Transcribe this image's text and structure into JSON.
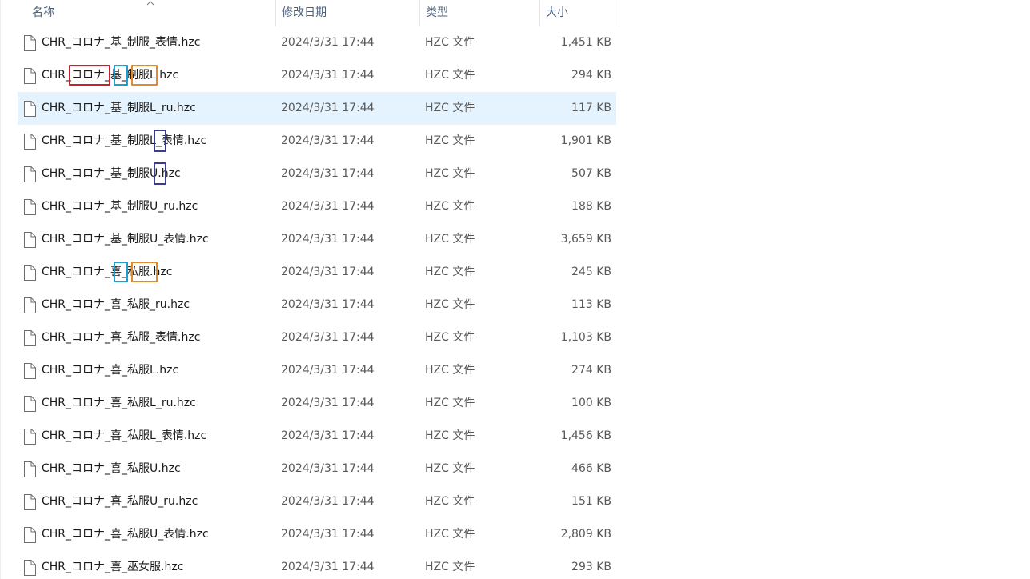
{
  "columns": {
    "name": "名称",
    "date": "修改日期",
    "type": "类型",
    "size": "大小"
  },
  "files": [
    {
      "name": "CHR_コロナ_基_制服_表情.hzc",
      "date": "2024/3/31 17:44",
      "type": "HZC 文件",
      "size": "1,451 KB"
    },
    {
      "name": "CHR_コロナ_基_制服L.hzc",
      "date": "2024/3/31 17:44",
      "type": "HZC 文件",
      "size": "294 KB"
    },
    {
      "name": "CHR_コロナ_基_制服L_ru.hzc",
      "date": "2024/3/31 17:44",
      "type": "HZC 文件",
      "size": "117 KB"
    },
    {
      "name": "CHR_コロナ_基_制服L_表情.hzc",
      "date": "2024/3/31 17:44",
      "type": "HZC 文件",
      "size": "1,901 KB"
    },
    {
      "name": "CHR_コロナ_基_制服U.hzc",
      "date": "2024/3/31 17:44",
      "type": "HZC 文件",
      "size": "507 KB"
    },
    {
      "name": "CHR_コロナ_基_制服U_ru.hzc",
      "date": "2024/3/31 17:44",
      "type": "HZC 文件",
      "size": "188 KB"
    },
    {
      "name": "CHR_コロナ_基_制服U_表情.hzc",
      "date": "2024/3/31 17:44",
      "type": "HZC 文件",
      "size": "3,659 KB"
    },
    {
      "name": "CHR_コロナ_喜_私服.hzc",
      "date": "2024/3/31 17:44",
      "type": "HZC 文件",
      "size": "245 KB"
    },
    {
      "name": "CHR_コロナ_喜_私服_ru.hzc",
      "date": "2024/3/31 17:44",
      "type": "HZC 文件",
      "size": "113 KB"
    },
    {
      "name": "CHR_コロナ_喜_私服_表情.hzc",
      "date": "2024/3/31 17:44",
      "type": "HZC 文件",
      "size": "1,103 KB"
    },
    {
      "name": "CHR_コロナ_喜_私服L.hzc",
      "date": "2024/3/31 17:44",
      "type": "HZC 文件",
      "size": "274 KB"
    },
    {
      "name": "CHR_コロナ_喜_私服L_ru.hzc",
      "date": "2024/3/31 17:44",
      "type": "HZC 文件",
      "size": "100 KB"
    },
    {
      "name": "CHR_コロナ_喜_私服L_表情.hzc",
      "date": "2024/3/31 17:44",
      "type": "HZC 文件",
      "size": "1,456 KB"
    },
    {
      "name": "CHR_コロナ_喜_私服U.hzc",
      "date": "2024/3/31 17:44",
      "type": "HZC 文件",
      "size": "466 KB"
    },
    {
      "name": "CHR_コロナ_喜_私服U_ru.hzc",
      "date": "2024/3/31 17:44",
      "type": "HZC 文件",
      "size": "151 KB"
    },
    {
      "name": "CHR_コロナ_喜_私服U_表情.hzc",
      "date": "2024/3/31 17:44",
      "type": "HZC 文件",
      "size": "2,809 KB"
    },
    {
      "name": "CHR_コロナ_喜_巫女服.hzc",
      "date": "2024/3/31 17:44",
      "type": "HZC 文件",
      "size": "293 KB"
    }
  ],
  "selected_index": 2,
  "colors": {
    "selection": "#e5f3ff",
    "header_text": "#4c607a",
    "box_red": "#c8202f",
    "box_cyan": "#1f9fd1",
    "box_orange": "#e08a2e",
    "box_navy": "#3c3c8c"
  },
  "icons": {
    "sort": "chevron-up-icon",
    "file": "file-icon"
  }
}
